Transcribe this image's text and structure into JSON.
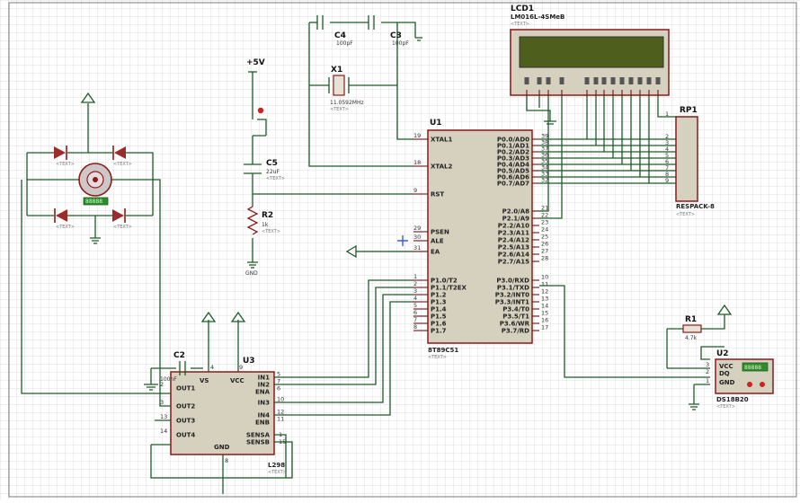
{
  "components": {
    "lcd1": {
      "ref": "LCD1",
      "part": "LM016L-4SMeB"
    },
    "u1": {
      "ref": "U1",
      "part": "8T89C51",
      "left_pins": [
        {
          "num": "19",
          "name": "XTAL1"
        },
        {
          "num": "18",
          "name": "XTAL2"
        },
        {
          "num": "9",
          "name": "RST"
        },
        {
          "num": "29",
          "name": "PSEN"
        },
        {
          "num": "30",
          "name": "ALE"
        },
        {
          "num": "31",
          "name": "EA"
        },
        {
          "num": "1",
          "name": "P1.0/T2"
        },
        {
          "num": "2",
          "name": "P1.1/T2EX"
        },
        {
          "num": "3",
          "name": "P1.2"
        },
        {
          "num": "4",
          "name": "P1.3"
        },
        {
          "num": "5",
          "name": "P1.4"
        },
        {
          "num": "6",
          "name": "P1.5"
        },
        {
          "num": "7",
          "name": "P1.6"
        },
        {
          "num": "8",
          "name": "P1.7"
        }
      ],
      "right_pins": [
        {
          "num": "39",
          "name": "P0.0/AD0"
        },
        {
          "num": "38",
          "name": "P0.1/AD1"
        },
        {
          "num": "37",
          "name": "P0.2/AD2"
        },
        {
          "num": "36",
          "name": "P0.3/AD3"
        },
        {
          "num": "35",
          "name": "P0.4/AD4"
        },
        {
          "num": "34",
          "name": "P0.5/AD5"
        },
        {
          "num": "33",
          "name": "P0.6/AD6"
        },
        {
          "num": "32",
          "name": "P0.7/AD7"
        },
        {
          "num": "21",
          "name": "P2.0/A8"
        },
        {
          "num": "22",
          "name": "P2.1/A9"
        },
        {
          "num": "23",
          "name": "P2.2/A10"
        },
        {
          "num": "24",
          "name": "P2.3/A11"
        },
        {
          "num": "25",
          "name": "P2.4/A12"
        },
        {
          "num": "26",
          "name": "P2.5/A13"
        },
        {
          "num": "27",
          "name": "P2.6/A14"
        },
        {
          "num": "28",
          "name": "P2.7/A15"
        },
        {
          "num": "10",
          "name": "P3.0/RXD"
        },
        {
          "num": "11",
          "name": "P3.1/TXD"
        },
        {
          "num": "12",
          "name": "P3.2/INT0"
        },
        {
          "num": "13",
          "name": "P3.3/INT1"
        },
        {
          "num": "14",
          "name": "P3.4/T0"
        },
        {
          "num": "15",
          "name": "P3.5/T1"
        },
        {
          "num": "16",
          "name": "P3.6/WR"
        },
        {
          "num": "17",
          "name": "P3.7/RD"
        }
      ]
    },
    "u3": {
      "ref": "U3",
      "part": "L298",
      "pins_left": [
        {
          "num": "2",
          "name": "OUT1"
        },
        {
          "num": "3",
          "name": "OUT2"
        },
        {
          "num": "13",
          "name": "OUT3"
        },
        {
          "num": "14",
          "name": "OUT4"
        }
      ],
      "pins_right": [
        {
          "num": "5",
          "name": "IN1"
        },
        {
          "num": "7",
          "name": "IN2"
        },
        {
          "num": "10",
          "name": "IN3"
        },
        {
          "num": "12",
          "name": "IN4"
        },
        {
          "num": "6",
          "name": "ENA"
        },
        {
          "num": "11",
          "name": "ENB"
        }
      ],
      "pins_bottom": [
        {
          "num": "1",
          "name": "SENSA"
        },
        {
          "num": "15",
          "name": "SENSB"
        }
      ],
      "vs": "VS",
      "vcc": "VCC",
      "gnd": "GND",
      "vs_pin": "4",
      "vcc_pin": "9",
      "gnd_pin": "8"
    },
    "u2": {
      "ref": "U2",
      "part": "DS18B20",
      "pins": [
        "VCC",
        "DQ",
        "GND"
      ],
      "pin_nums": [
        "3",
        "2",
        "1"
      ],
      "reading": "88888"
    },
    "rp1": {
      "ref": "RP1",
      "part": "RESPACK-8",
      "pin_nums": [
        "1",
        "2",
        "3",
        "4",
        "5",
        "6",
        "7",
        "8",
        "9"
      ]
    },
    "c4": {
      "ref": "C4",
      "value": "100pF"
    },
    "c3": {
      "ref": "C3",
      "value": "100pF"
    },
    "x1": {
      "ref": "X1",
      "value": "11.0592MHz"
    },
    "c5": {
      "ref": "C5",
      "value": "22uF"
    },
    "r2": {
      "ref": "R2",
      "value": "1k"
    },
    "r1": {
      "ref": "R1",
      "value": "4.7k"
    },
    "c2": {
      "ref": "C2",
      "value": "100nF"
    },
    "motor_label": "88888",
    "power_label": "+5V",
    "gnd_label": "GND",
    "text_placeholder": "<TEXT>"
  },
  "colors": {
    "background": "#ffffff",
    "grid": "#d5d5d5",
    "wire": "#1e5a28",
    "component_outline": "#8a1a1a",
    "chip_fill": "#d6d1bf",
    "lcd_screen": "#4e5e1c",
    "diode_fill": "#9c2b2b",
    "display_green": "#2e8b2e",
    "probe_red": "#cc2222",
    "cursor_blue": "#3a5bd9"
  }
}
